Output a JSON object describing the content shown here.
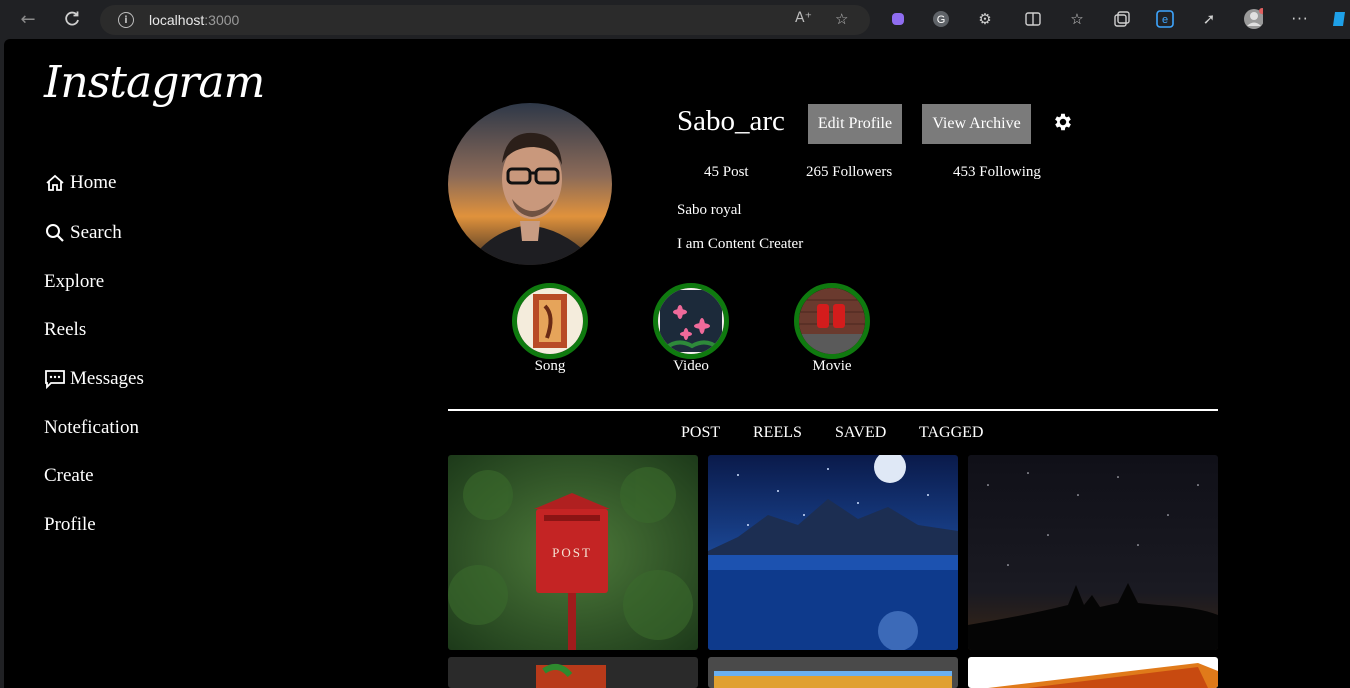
{
  "browser": {
    "url_host": "localhost",
    "url_port": ":3000"
  },
  "app": {
    "logo": "Instagram"
  },
  "sidebar": {
    "items": [
      {
        "label": "Home",
        "icon": "home-icon"
      },
      {
        "label": "Search",
        "icon": "search-icon"
      },
      {
        "label": "Explore"
      },
      {
        "label": "Reels"
      },
      {
        "label": "Messages",
        "icon": "message-icon"
      },
      {
        "label": "Notefication"
      },
      {
        "label": "Create"
      },
      {
        "label": "Profile"
      }
    ]
  },
  "profile": {
    "username": "Sabo_arc",
    "edit_button": "Edit Profile",
    "archive_button": "View Archive",
    "settings_icon": "gear-icon",
    "stats": {
      "posts": "45 Post",
      "followers": "265 Followers",
      "following": "453 Following"
    },
    "name": "Sabo royal",
    "bio": "I am Content Creater"
  },
  "highlights": [
    {
      "label": "Song"
    },
    {
      "label": "Video"
    },
    {
      "label": "Movie"
    }
  ],
  "tabs": [
    {
      "label": "POST"
    },
    {
      "label": "REELS"
    },
    {
      "label": "SAVED"
    },
    {
      "label": "TAGGED"
    }
  ],
  "posts": [
    {
      "caption": "POST"
    }
  ],
  "colors": {
    "highlight_ring": "#0f7a0f",
    "button_bg": "#7b7b7b",
    "page_bg": "#000000"
  }
}
